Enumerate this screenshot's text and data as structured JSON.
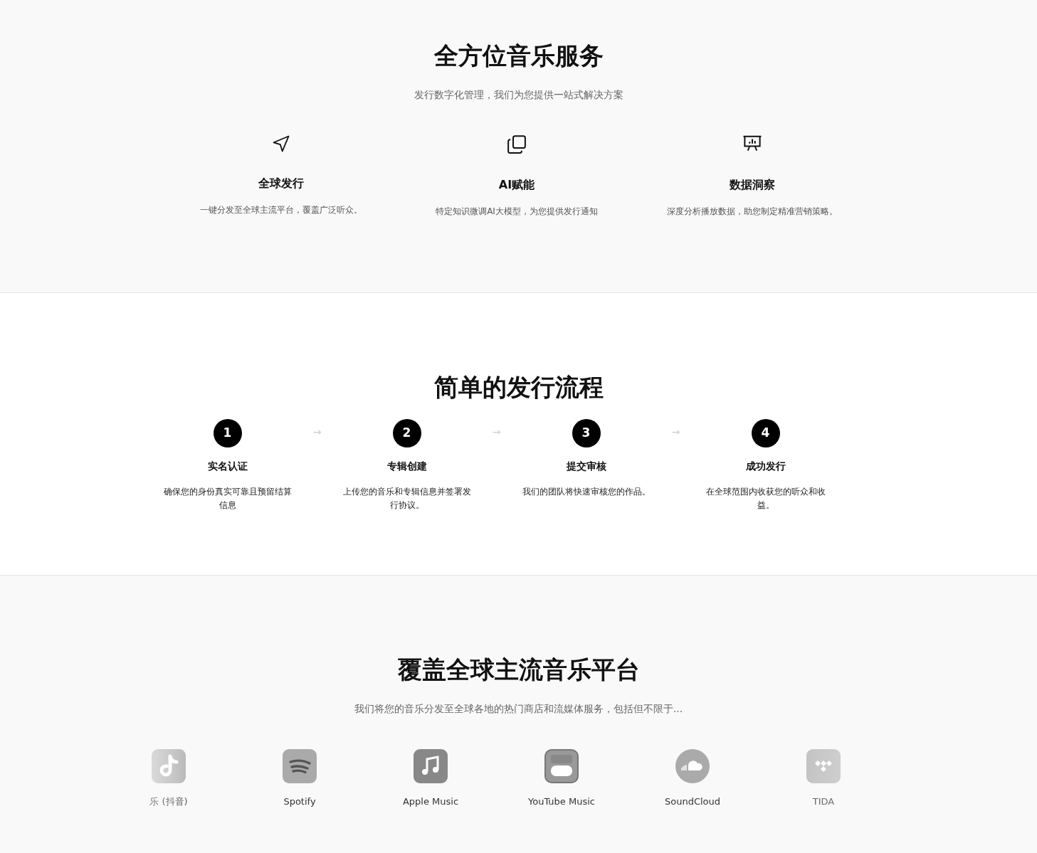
{
  "services": {
    "title": "全方位音乐服务",
    "subtitle": "发行数字化管理，我们为您提供一站式解决方案",
    "features": [
      {
        "kind": "send",
        "title": "全球发行",
        "text": "一键分发至全球主流平台，覆盖广泛听众。"
      },
      {
        "kind": "copy",
        "title": "AI赋能",
        "text": "特定知识微调AI大模型，为您提供发行通知"
      },
      {
        "kind": "presentation",
        "title": "数据洞察",
        "text": "深度分析播放数据，助您制定精准营销策略。"
      }
    ]
  },
  "process": {
    "title": "简单的发行流程",
    "steps": [
      {
        "number": "1",
        "title": "实名认证",
        "text": "确保您的身份真实可靠且预留结算信息"
      },
      {
        "number": "2",
        "title": "专辑创建",
        "text": "上传您的音乐和专辑信息并签署发行协议。"
      },
      {
        "number": "3",
        "title": "提交审核",
        "text": "我们的团队将快速审核您的作品。"
      },
      {
        "number": "4",
        "title": "成功发行",
        "text": "在全球范围内收获您的听众和收益。"
      }
    ],
    "arrows": [
      "→",
      "→",
      "→"
    ]
  },
  "platforms": {
    "title": "覆盖全球主流音乐平台",
    "subtitle": "我们将您的音乐分发至全球各地的热门商店和流媒体服务，包括但不限于...",
    "items": [
      {
        "kind": "tiktok",
        "name": "乐 (抖音)"
      },
      {
        "kind": "spotify",
        "name": "Spotify"
      },
      {
        "kind": "apple",
        "name": "Apple Music"
      },
      {
        "kind": "youtube",
        "name": "YouTube Music"
      },
      {
        "kind": "soundcloud",
        "name": "SoundCloud"
      },
      {
        "kind": "tidal",
        "name": "TIDA"
      }
    ]
  }
}
